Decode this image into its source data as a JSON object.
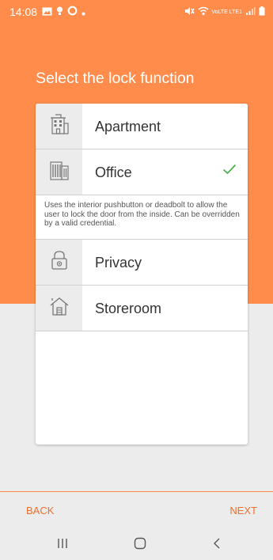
{
  "status_bar": {
    "time": "14:08",
    "network_label": "VoLTE LTE1",
    "bg_color": "#ff8c4b"
  },
  "screen": {
    "heading": "Select the lock function",
    "accent_color": "#ff8c4b"
  },
  "lock_functions": [
    {
      "label": "Apartment",
      "icon": "apartment-building-icon",
      "selected": false
    },
    {
      "label": "Office",
      "icon": "office-building-icon",
      "selected": true,
      "description": "Uses the interior pushbutton or deadbolt to allow the user to lock the door from the inside. Can be overridden by a valid credential."
    },
    {
      "label": "Privacy",
      "icon": "privacy-lock-icon",
      "selected": false
    },
    {
      "label": "Storeroom",
      "icon": "storeroom-house-icon",
      "selected": false
    }
  ],
  "footer": {
    "back_label": "BACK",
    "next_label": "NEXT"
  },
  "system_nav": {
    "buttons": [
      "recent-apps-icon",
      "home-icon",
      "back-arrow-icon"
    ]
  },
  "colors": {
    "check": "#4caf50",
    "nav_text": "#f06f2c",
    "background": "#ececec"
  }
}
